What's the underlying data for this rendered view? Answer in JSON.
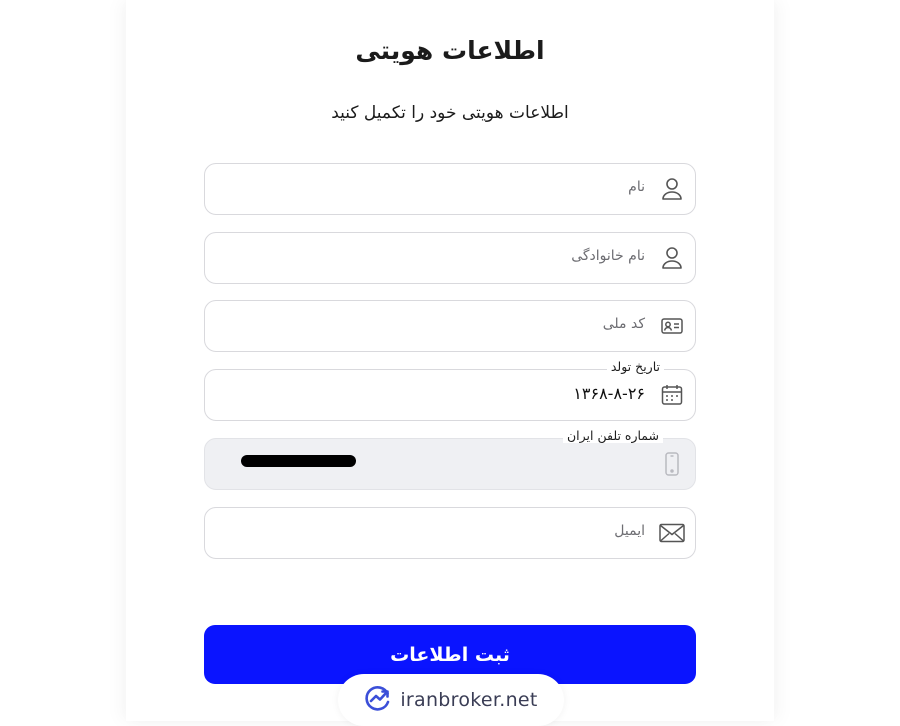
{
  "header": {
    "title": "اطلاعات هویتی",
    "subtitle": "اطلاعات هویتی خود را تکمیل کنید"
  },
  "form": {
    "first_name": {
      "placeholder": "نام",
      "icon": "user-icon"
    },
    "last_name": {
      "placeholder": "نام خانوادگی",
      "icon": "user-icon"
    },
    "national_code": {
      "placeholder": "کد ملی",
      "icon": "id-card-icon"
    },
    "birth_date": {
      "label": "تاریخ تولد",
      "value": "۱۳۶۸-۸-۲۶",
      "icon": "calendar-icon"
    },
    "phone": {
      "label": "شماره تلفن ایران",
      "icon": "mobile-phone-icon"
    },
    "email": {
      "placeholder": "ایمیل",
      "icon": "envelope-icon"
    },
    "submit_label": "ثبت اطلاعات"
  },
  "watermark": {
    "text": "iranbroker.net",
    "icon": "growth-chart-icon"
  },
  "colors": {
    "primary": "#0a14ff",
    "disabled_bg": "#eff0f3",
    "border": "#d9d9dd"
  }
}
